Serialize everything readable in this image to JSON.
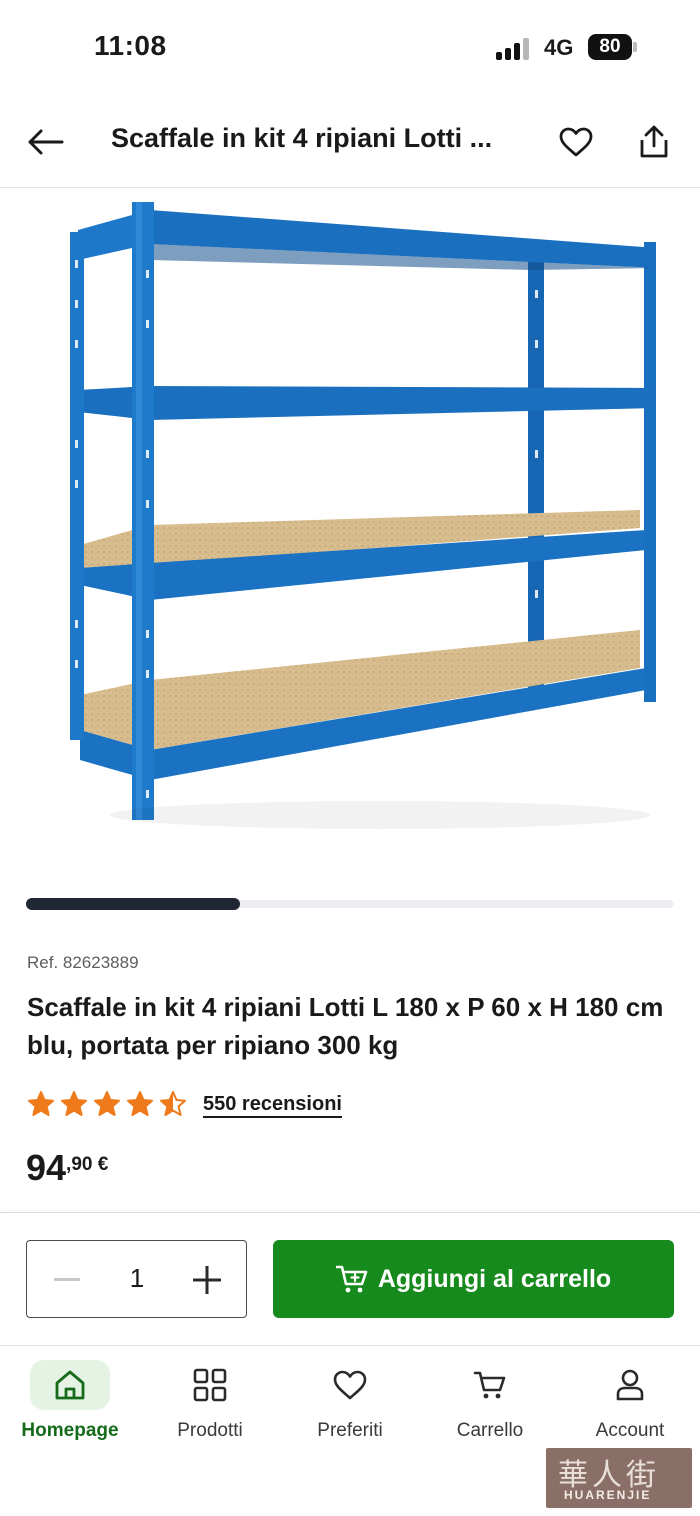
{
  "status_bar": {
    "time": "11:08",
    "network": "4G",
    "battery": "80"
  },
  "header": {
    "title": "Scaffale in kit 4 ripiani Lotti ...",
    "back_icon": "arrow-left-icon",
    "favorite_icon": "heart-icon",
    "share_icon": "share-icon"
  },
  "gallery": {
    "image_description_icon": "product-image",
    "progress": 0.33,
    "shelf_color": "#1c6fbe"
  },
  "product": {
    "ref": "Ref. 82623889",
    "title": "Scaffale in kit 4 ripiani Lotti L 180 x P 60 x H 180 cm blu, portata per ripiano 300 kg",
    "rating": 4.5,
    "rating_max": 5,
    "star_color": "#ee7a1b",
    "reviews_label": "550 recensioni",
    "price_integer": "94",
    "price_decimal": ",90 €"
  },
  "purchase": {
    "quantity": "1",
    "add_to_cart_label": "Aggiungi al carrello",
    "button_color": "#178a1d"
  },
  "bottom_nav": {
    "items": [
      {
        "label": "Homepage",
        "icon": "home-icon",
        "active": true
      },
      {
        "label": "Prodotti",
        "icon": "grid-icon",
        "active": false
      },
      {
        "label": "Preferiti",
        "icon": "heart-icon",
        "active": false
      },
      {
        "label": "Carrello",
        "icon": "cart-icon",
        "active": false
      },
      {
        "label": "Account",
        "icon": "user-icon",
        "active": false
      }
    ]
  },
  "watermark": {
    "text": "華人街",
    "subtext": "HUARENJIE"
  }
}
